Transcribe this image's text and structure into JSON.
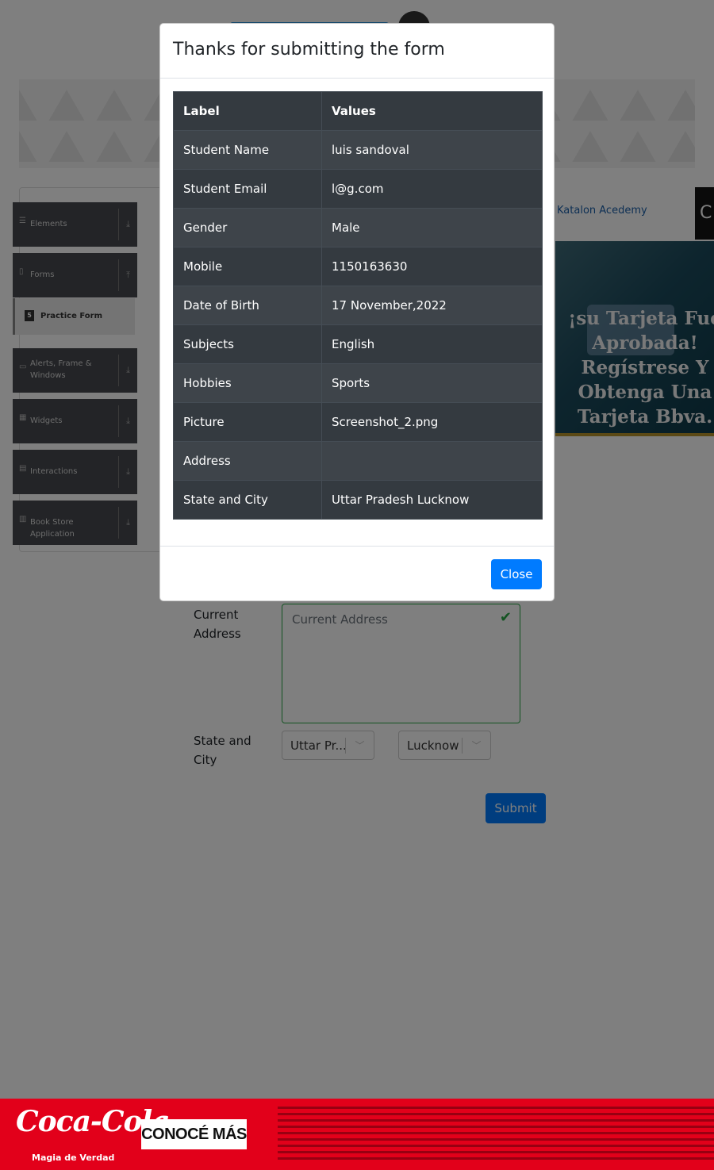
{
  "sidebar": {
    "elements": "Elements",
    "forms": "Forms",
    "practice_form": "Practice Form",
    "alerts": "Alerts, Frame & Windows",
    "widgets": "Widgets",
    "interactions": "Interactions",
    "book_store": "Book Store Application"
  },
  "ads": {
    "katalon_link": "Katalon Acedemy",
    "bbva_text": "¡su Tarjeta Fue Aprobada! Regístrese Y Obtenga Una Tarjeta Bbva.",
    "coca_cola_logo": "Coca-Cola",
    "coca_cola_tagline": "Magia de Verdad",
    "coca_cola_button": "CONOCÉ MÁS"
  },
  "form": {
    "current_address_label": "Current Address",
    "current_address_placeholder": "Current Address",
    "state_city_label": "State and City",
    "state_value": "Uttar Pr...",
    "city_value": "Lucknow",
    "submit_label": "Submit"
  },
  "modal": {
    "title": "Thanks for submitting the form",
    "columns": [
      "Label",
      "Values"
    ],
    "rows": [
      {
        "label": "Student Name",
        "value": "luis sandoval"
      },
      {
        "label": "Student Email",
        "value": "l@g.com"
      },
      {
        "label": "Gender",
        "value": "Male"
      },
      {
        "label": "Mobile",
        "value": "1150163630"
      },
      {
        "label": "Date of Birth",
        "value": "17 November,2022"
      },
      {
        "label": "Subjects",
        "value": "English"
      },
      {
        "label": "Hobbies",
        "value": "Sports"
      },
      {
        "label": "Picture",
        "value": "Screenshot_2.png"
      },
      {
        "label": "Address",
        "value": ""
      },
      {
        "label": "State and City",
        "value": "Uttar Pradesh Lucknow"
      }
    ],
    "close_label": "Close"
  },
  "colors": {
    "primary": "#007bff",
    "table_dark": "#343a40",
    "success": "#28a745",
    "coca_cola_red": "#e2001a"
  },
  "icons": {
    "menu": "hamburger-icon",
    "expand": "download-arrow-icon",
    "valid": "checkmark-icon",
    "dropdown": "chevron-down-icon"
  }
}
